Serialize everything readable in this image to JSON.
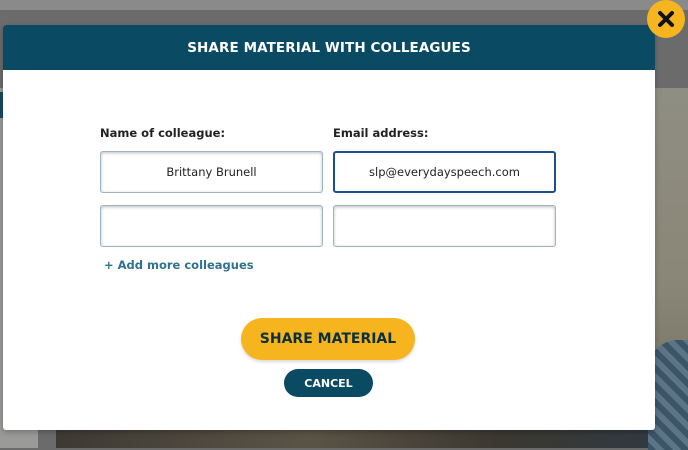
{
  "modal": {
    "title": "SHARE MATERIAL WITH COLLEAGUES",
    "labels": {
      "name": "Name of colleague:",
      "email": "Email address:"
    },
    "rows": [
      {
        "name": "Brittany Brunell",
        "email": "slp@everydayspeech.com"
      },
      {
        "name": "",
        "email": ""
      }
    ],
    "add_more": "+ Add more colleagues",
    "share_label": "SHARE MATERIAL",
    "cancel_label": "CANCEL",
    "close_icon": "close-x-icon"
  },
  "colors": {
    "header": "#0a4a63",
    "accent": "#f6b51f",
    "link": "#2f7390"
  }
}
